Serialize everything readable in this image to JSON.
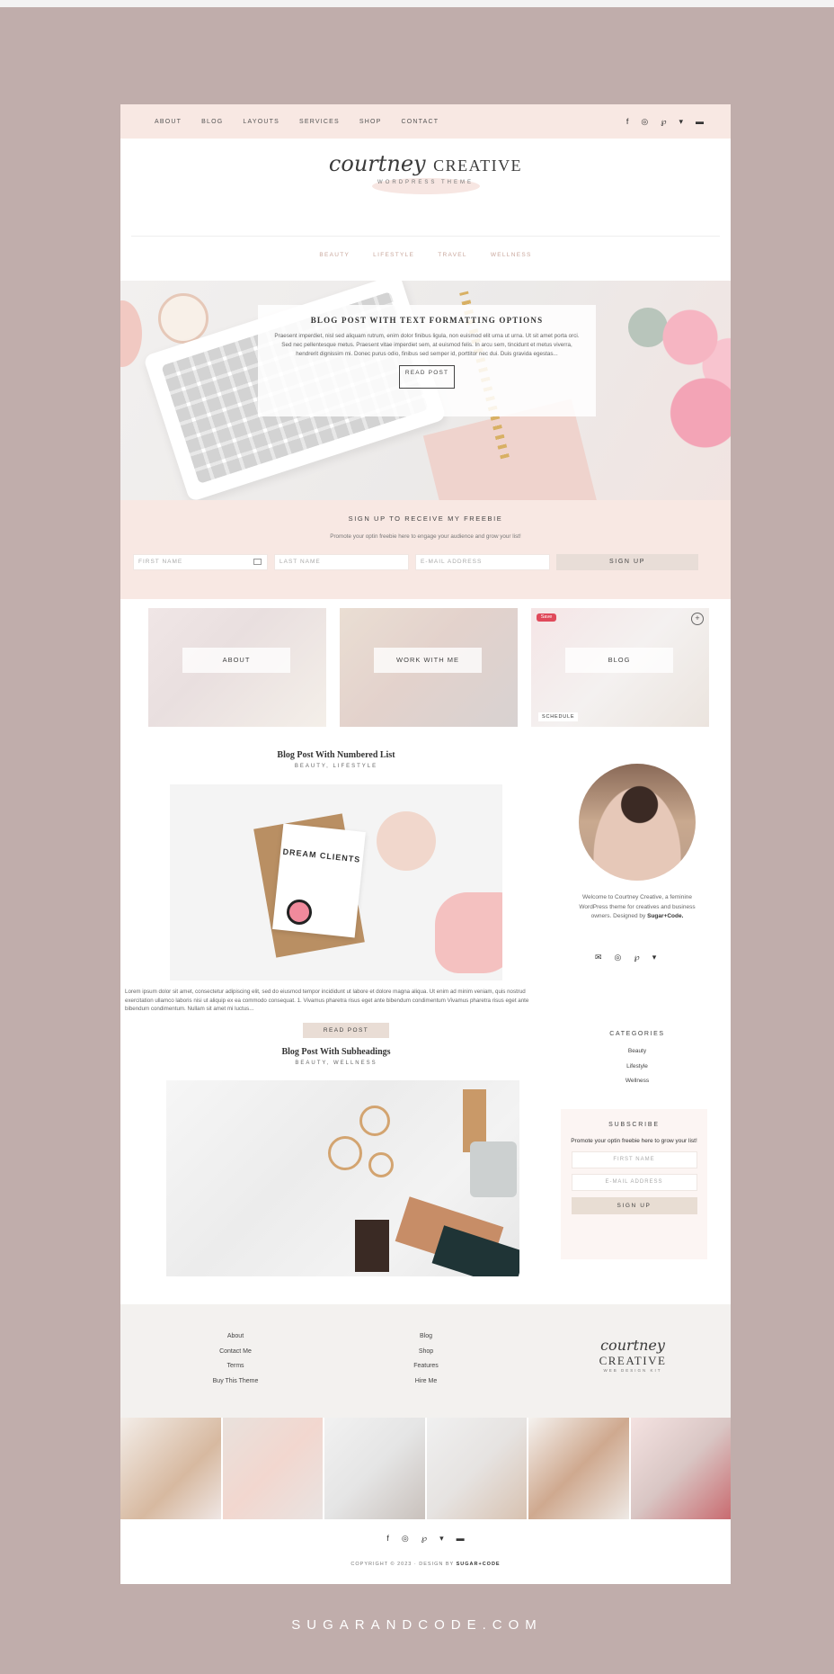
{
  "topnav": {
    "items": [
      "ABOUT",
      "BLOG",
      "LAYOUTS",
      "SERVICES",
      "SHOP",
      "CONTACT"
    ]
  },
  "social_icons": [
    "facebook-icon",
    "instagram-icon",
    "pinterest-icon",
    "twitter-icon",
    "youtube-icon"
  ],
  "logo": {
    "script": "courtney",
    "caps": "CREATIVE",
    "sub": "WORDPRESS THEME"
  },
  "catnav": {
    "items": [
      "BEAUTY",
      "LIFESTYLE",
      "TRAVEL",
      "WELLNESS"
    ]
  },
  "hero": {
    "title": "BLOG POST WITH TEXT FORMATTING OPTIONS",
    "excerpt": "Praesent imperdiet, nisl sed aliquam rutrum, enim dolor finibus ligula, non euismod elit urna ut urna. Ut sit amet porta orci. Sed nec pellentesque metus. Praesent vitae imperdiet sem, at euismod felis. In arcu sem, tincidunt et metus viverra, hendrerit dignissim mi. Donec purus odio, finibus sed semper id, porttitor nec dui. Duis gravida egestas...",
    "button": "READ POST"
  },
  "optin": {
    "title": "SIGN UP TO RECEIVE MY FREEBIE",
    "desc": "Promote your optin freebie here to engage your audience and grow your list!",
    "first": "FIRST NAME",
    "last": "LAST NAME",
    "email": "E-MAIL ADDRESS",
    "button": "SIGN UP"
  },
  "tiles": {
    "about": "ABOUT",
    "work": "WORK WITH ME",
    "blog": "BLOG",
    "save": "Save",
    "schedule": "SCHEDULE"
  },
  "post1": {
    "title": "Blog Post With Numbered List",
    "cats": "BEAUTY, LIFESTYLE",
    "card_text": "DREAM CLIENTS",
    "excerpt": "Lorem ipsum dolor sit amet, consectetur adipiscing elit, sed do eiusmod tempor incididunt ut labore et dolore magna aliqua. Ut enim ad minim veniam, quis nostrud exercitation ullamco laboris nisi ut aliquip ex ea commodo consequat. 1. Vivamus pharetra risus eget ante bibendum condimentum Vivamus pharetra risus eget ante bibendum condimentum. Nullam sit amet mi luctus...",
    "button": "READ POST"
  },
  "sidebar": {
    "bio_prefix": "Welcome to Courtney Creative, a feminine WordPress theme for creatives and business owners. Designed by",
    "bio_brand": "Sugar+Code.",
    "social_icons": [
      "email-icon",
      "instagram-icon",
      "pinterest-icon",
      "twitter-icon"
    ],
    "categories_title": "CATEGORIES",
    "categories": [
      "Beauty",
      "Lifestyle",
      "Wellness"
    ],
    "subscribe": {
      "title": "SUBSCRIBE",
      "desc": "Promote your optin freebie here to grow your list!",
      "first": "FIRST NAME",
      "email": "E-MAIL ADDRESS",
      "button": "SIGN UP"
    }
  },
  "post2": {
    "title": "Blog Post With Subheadings",
    "cats": "BEAUTY, WELLNESS"
  },
  "footer": {
    "col1": [
      "About",
      "Contact Me",
      "Terms",
      "Buy This Theme"
    ],
    "col2": [
      "Blog",
      "Shop",
      "Features",
      "Hire Me"
    ],
    "logo_script": "courtney",
    "logo_caps": "CREATIVE",
    "logo_sub": "WEB DESIGN KIT",
    "copyright_prefix": "COPYRIGHT © 2023 · DESIGN BY",
    "copyright_brand": "SUGAR+CODE"
  },
  "site_url": "SUGARANDCODE.COM",
  "colors": {
    "background": "#c0adab",
    "blush": "#f8e8e3",
    "accent": "#c9a79c",
    "button": "#e8ddd7"
  }
}
